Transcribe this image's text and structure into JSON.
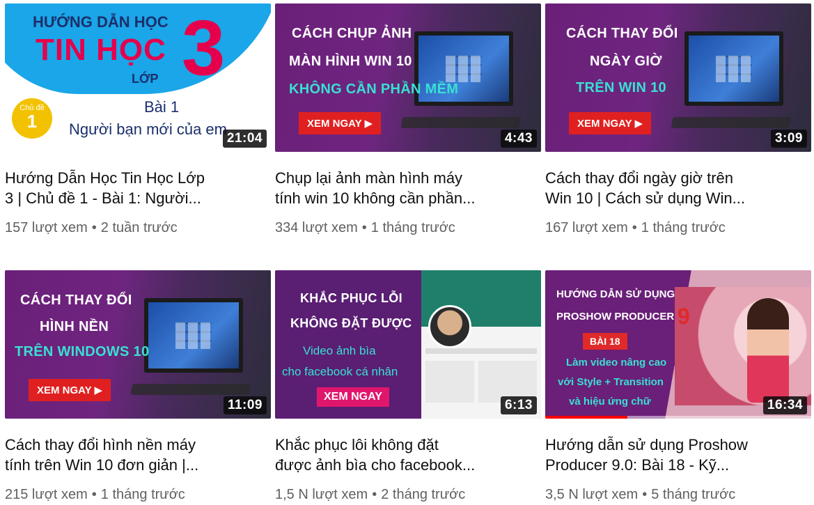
{
  "videos": [
    {
      "thumb": {
        "line1": "HƯỚNG DẪN HỌC",
        "line2": "TIN HỌC",
        "line3": "LỚP",
        "number": "3",
        "badge_top": "Chủ đề",
        "badge_num": "1",
        "lesson": "Bài 1",
        "subtitle": "Người bạn mới của em"
      },
      "duration": "21:04",
      "title_line1": "Hướng Dẫn Học Tin Học Lớp",
      "title_line2": "3 | Chủ đề 1 - Bài 1: Người...",
      "views": "157 lượt xem",
      "age": "2 tuần trước"
    },
    {
      "thumb": {
        "line1": "CÁCH CHỤP ẢNH",
        "line2": "MÀN HÌNH WIN 10",
        "line3": "KHÔNG CẦN PHẦN MỀM",
        "cta": "XEM NGAY ▶"
      },
      "duration": "4:43",
      "title_line1": "Chụp lại ảnh màn hình máy",
      "title_line2": "tính win 10 không cần phần...",
      "views": "334 lượt xem",
      "age": "1 tháng trước"
    },
    {
      "thumb": {
        "line1": "CÁCH THAY ĐỔI",
        "line2": "NGÀY GIỜ",
        "line3": "TRÊN WIN 10",
        "cta": "XEM NGAY ▶"
      },
      "duration": "3:09",
      "title_line1": "Cách thay đổi ngày giờ trên",
      "title_line2": "Win 10 | Cách sử dụng Win...",
      "views": "167 lượt xem",
      "age": "1 tháng trước"
    },
    {
      "thumb": {
        "line1": "CÁCH THAY ĐỔI",
        "line2": "HÌNH NỀN",
        "line3": "TRÊN WINDOWS 10",
        "cta": "XEM NGAY ▶"
      },
      "duration": "11:09",
      "title_line1": "Cách thay đổi hình nền máy",
      "title_line2": "tính trên Win 10 đơn giản |...",
      "views": "215 lượt xem",
      "age": "1 tháng trước"
    },
    {
      "thumb": {
        "line1": "KHẮC PHỤC LỖI",
        "line2": "KHÔNG ĐẶT ĐƯỢC",
        "line3": "Video ảnh bìa",
        "line4": "cho facebook cá nhân",
        "cta": "XEM NGAY"
      },
      "duration": "6:13",
      "title_line1": "Khắc phục lôi không đặt",
      "title_line2": "được ảnh bìa cho facebook...",
      "views": "1,5 N lượt xem",
      "age": "2 tháng trước"
    },
    {
      "thumb": {
        "line1": "HƯỚNG DẪN SỬ DỤNG",
        "line2": "PROSHOW PRODUCER",
        "number": "9",
        "lesson": "BÀI 18",
        "line3": "Làm video nâng cao",
        "line4": "với Style + Transition",
        "line5": "và hiệu ứng chữ",
        "watched_fraction": 0.31
      },
      "duration": "16:34",
      "title_line1": "Hướng dẫn sử dụng Proshow",
      "title_line2": "Producer 9.0: Bài 18 - Kỹ...",
      "views": "3,5 N lượt xem",
      "age": "5 tháng trước"
    }
  ],
  "separator": "•",
  "colors": {
    "title": "#0f0f0f",
    "meta": "#606060",
    "cta_red": "#e02020",
    "cyan_text": "#39e0d3",
    "thumb_purple": "#6a1f78"
  }
}
